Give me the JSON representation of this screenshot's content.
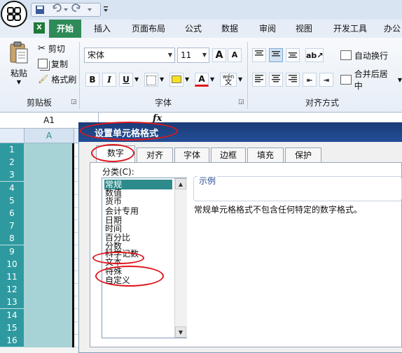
{
  "ribbon_tabs": [
    "开始",
    "插入",
    "页面布局",
    "公式",
    "数据",
    "审阅",
    "视图",
    "开发工具",
    "办公"
  ],
  "clipboard": {
    "paste_label": "粘贴",
    "cut_label": "剪切",
    "copy_label": "复制",
    "format_painter_label": "格式刷",
    "group_label": "剪贴板"
  },
  "font": {
    "font_name": "宋体",
    "font_size": "11",
    "bold": "B",
    "italic": "I",
    "underline": "U",
    "font_color_letter": "A",
    "phonetic_label": "wén",
    "phonetic_char": "文",
    "grow_letter": "A",
    "shrink_letter": "A",
    "group_label": "字体"
  },
  "alignment": {
    "wrap_text_label": "自动换行",
    "merge_center_label": "合并后居中",
    "group_label": "对齐方式"
  },
  "name_box": "A1",
  "fx_label": "fx",
  "sheet": {
    "column_a": "A",
    "rows": [
      "1",
      "2",
      "3",
      "4",
      "5",
      "6",
      "7",
      "8",
      "9",
      "10",
      "11",
      "12",
      "13",
      "14",
      "15",
      "16"
    ]
  },
  "dialog": {
    "title": "设置单元格格式",
    "tabs": [
      "数字",
      "对齐",
      "字体",
      "边框",
      "填充",
      "保护"
    ],
    "active_tab": "数字",
    "category_label": "分类(C):",
    "categories": [
      "常规",
      "数值",
      "货币",
      "会计专用",
      "日期",
      "时间",
      "百分比",
      "分数",
      "科学记数",
      "文本",
      "特殊",
      "自定义"
    ],
    "selected_category": "常规",
    "sample_label": "示例",
    "description": "常规单元格格式不包含任何特定的数字格式。"
  },
  "colors": {
    "active_tab": "#2e8b57",
    "dialog_title": "#1b3c78",
    "selection": "#2e8b8b",
    "annotation": "#e0161b"
  }
}
